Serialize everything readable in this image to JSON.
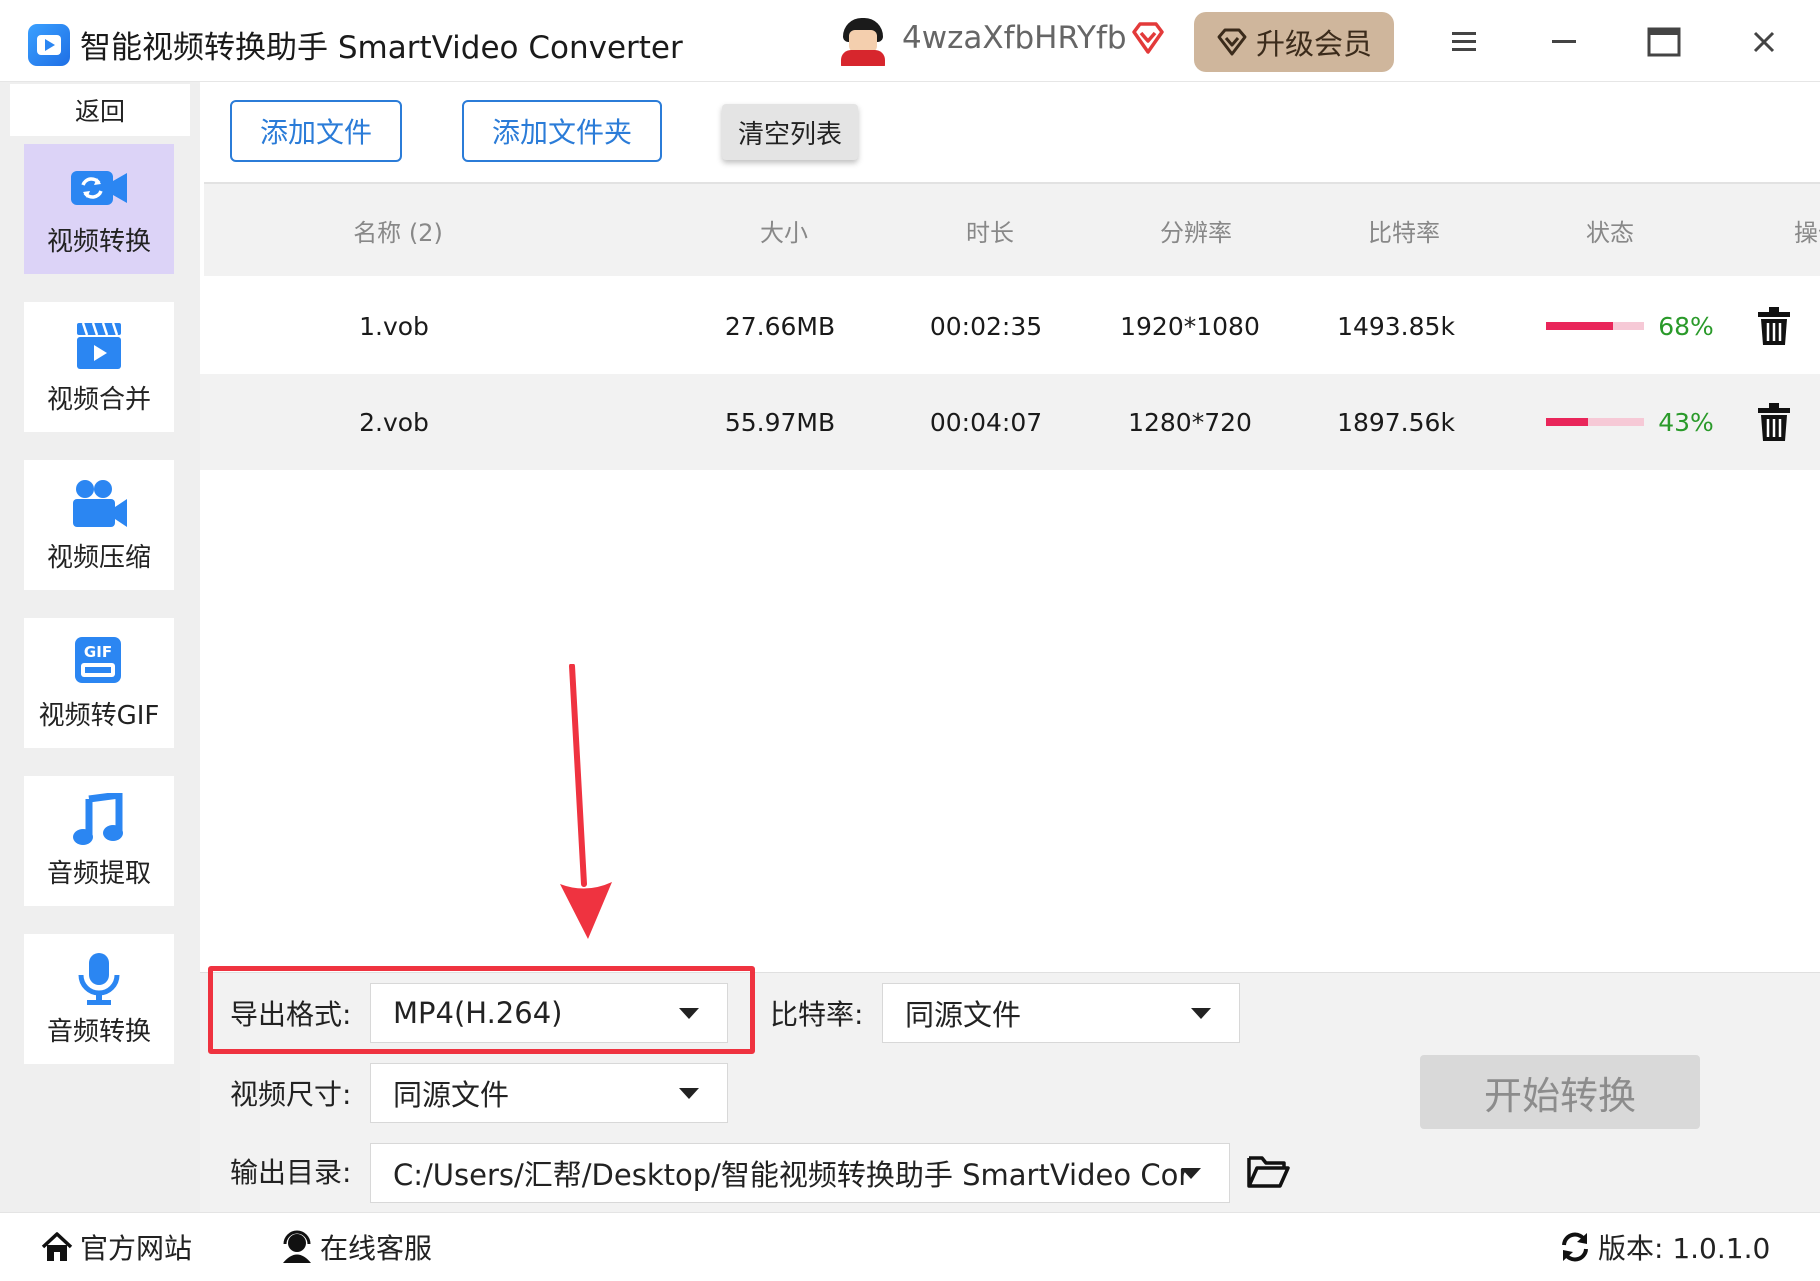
{
  "window": {
    "title": "智能视频转换助手 SmartVideo Converter",
    "username": "4wzaXfbHRYfb",
    "upgrade_label": "升级会员"
  },
  "sidebar": {
    "back_label": "返回",
    "items": [
      {
        "label": "视频转换",
        "icon": "video-convert-icon",
        "active": true
      },
      {
        "label": "视频合并",
        "icon": "video-merge-icon",
        "active": false
      },
      {
        "label": "视频压缩",
        "icon": "video-compress-icon",
        "active": false
      },
      {
        "label": "视频转GIF",
        "icon": "gif-icon",
        "active": false
      },
      {
        "label": "音频提取",
        "icon": "music-note-icon",
        "active": false
      },
      {
        "label": "音频转换",
        "icon": "microphone-icon",
        "active": false
      }
    ]
  },
  "toolbar": {
    "add_file": "添加文件",
    "add_folder": "添加文件夹",
    "clear_list": "清空列表"
  },
  "table": {
    "headers": [
      "名称 (2)",
      "大小",
      "时长",
      "分辨率",
      "比特率",
      "状态",
      "操作"
    ],
    "rows": [
      {
        "name": "1.vob",
        "size": "27.66MB",
        "duration": "00:02:35",
        "resolution": "1920*1080",
        "bitrate": "1493.85k",
        "progress": 0.68,
        "percent": "68%"
      },
      {
        "name": "2.vob",
        "size": "55.97MB",
        "duration": "00:04:07",
        "resolution": "1280*720",
        "bitrate": "1897.56k",
        "progress": 0.43,
        "percent": "43%"
      }
    ]
  },
  "settings": {
    "format_label": "导出格式:",
    "format_value": "MP4(H.264)",
    "bitrate_label": "比特率:",
    "bitrate_value": "同源文件",
    "size_label": "视频尺寸:",
    "size_value": "同源文件",
    "output_label": "输出目录:",
    "output_value": "C:/Users/汇帮/Desktop/智能视频转换助手 SmartVideo Cor",
    "start_label": "开始转换"
  },
  "footer": {
    "website": "官方网站",
    "support": "在线客服",
    "version": "版本: 1.0.1.0"
  },
  "colors": {
    "accent": "#2b7cd8",
    "highlight": "#ef3340",
    "progress_fill": "#e9265a",
    "progress_track": "#f6c9d6",
    "percent_text": "#2a9a2a",
    "active_nav": "#dcd3f7",
    "upgrade_bg": "#cfb69c"
  }
}
